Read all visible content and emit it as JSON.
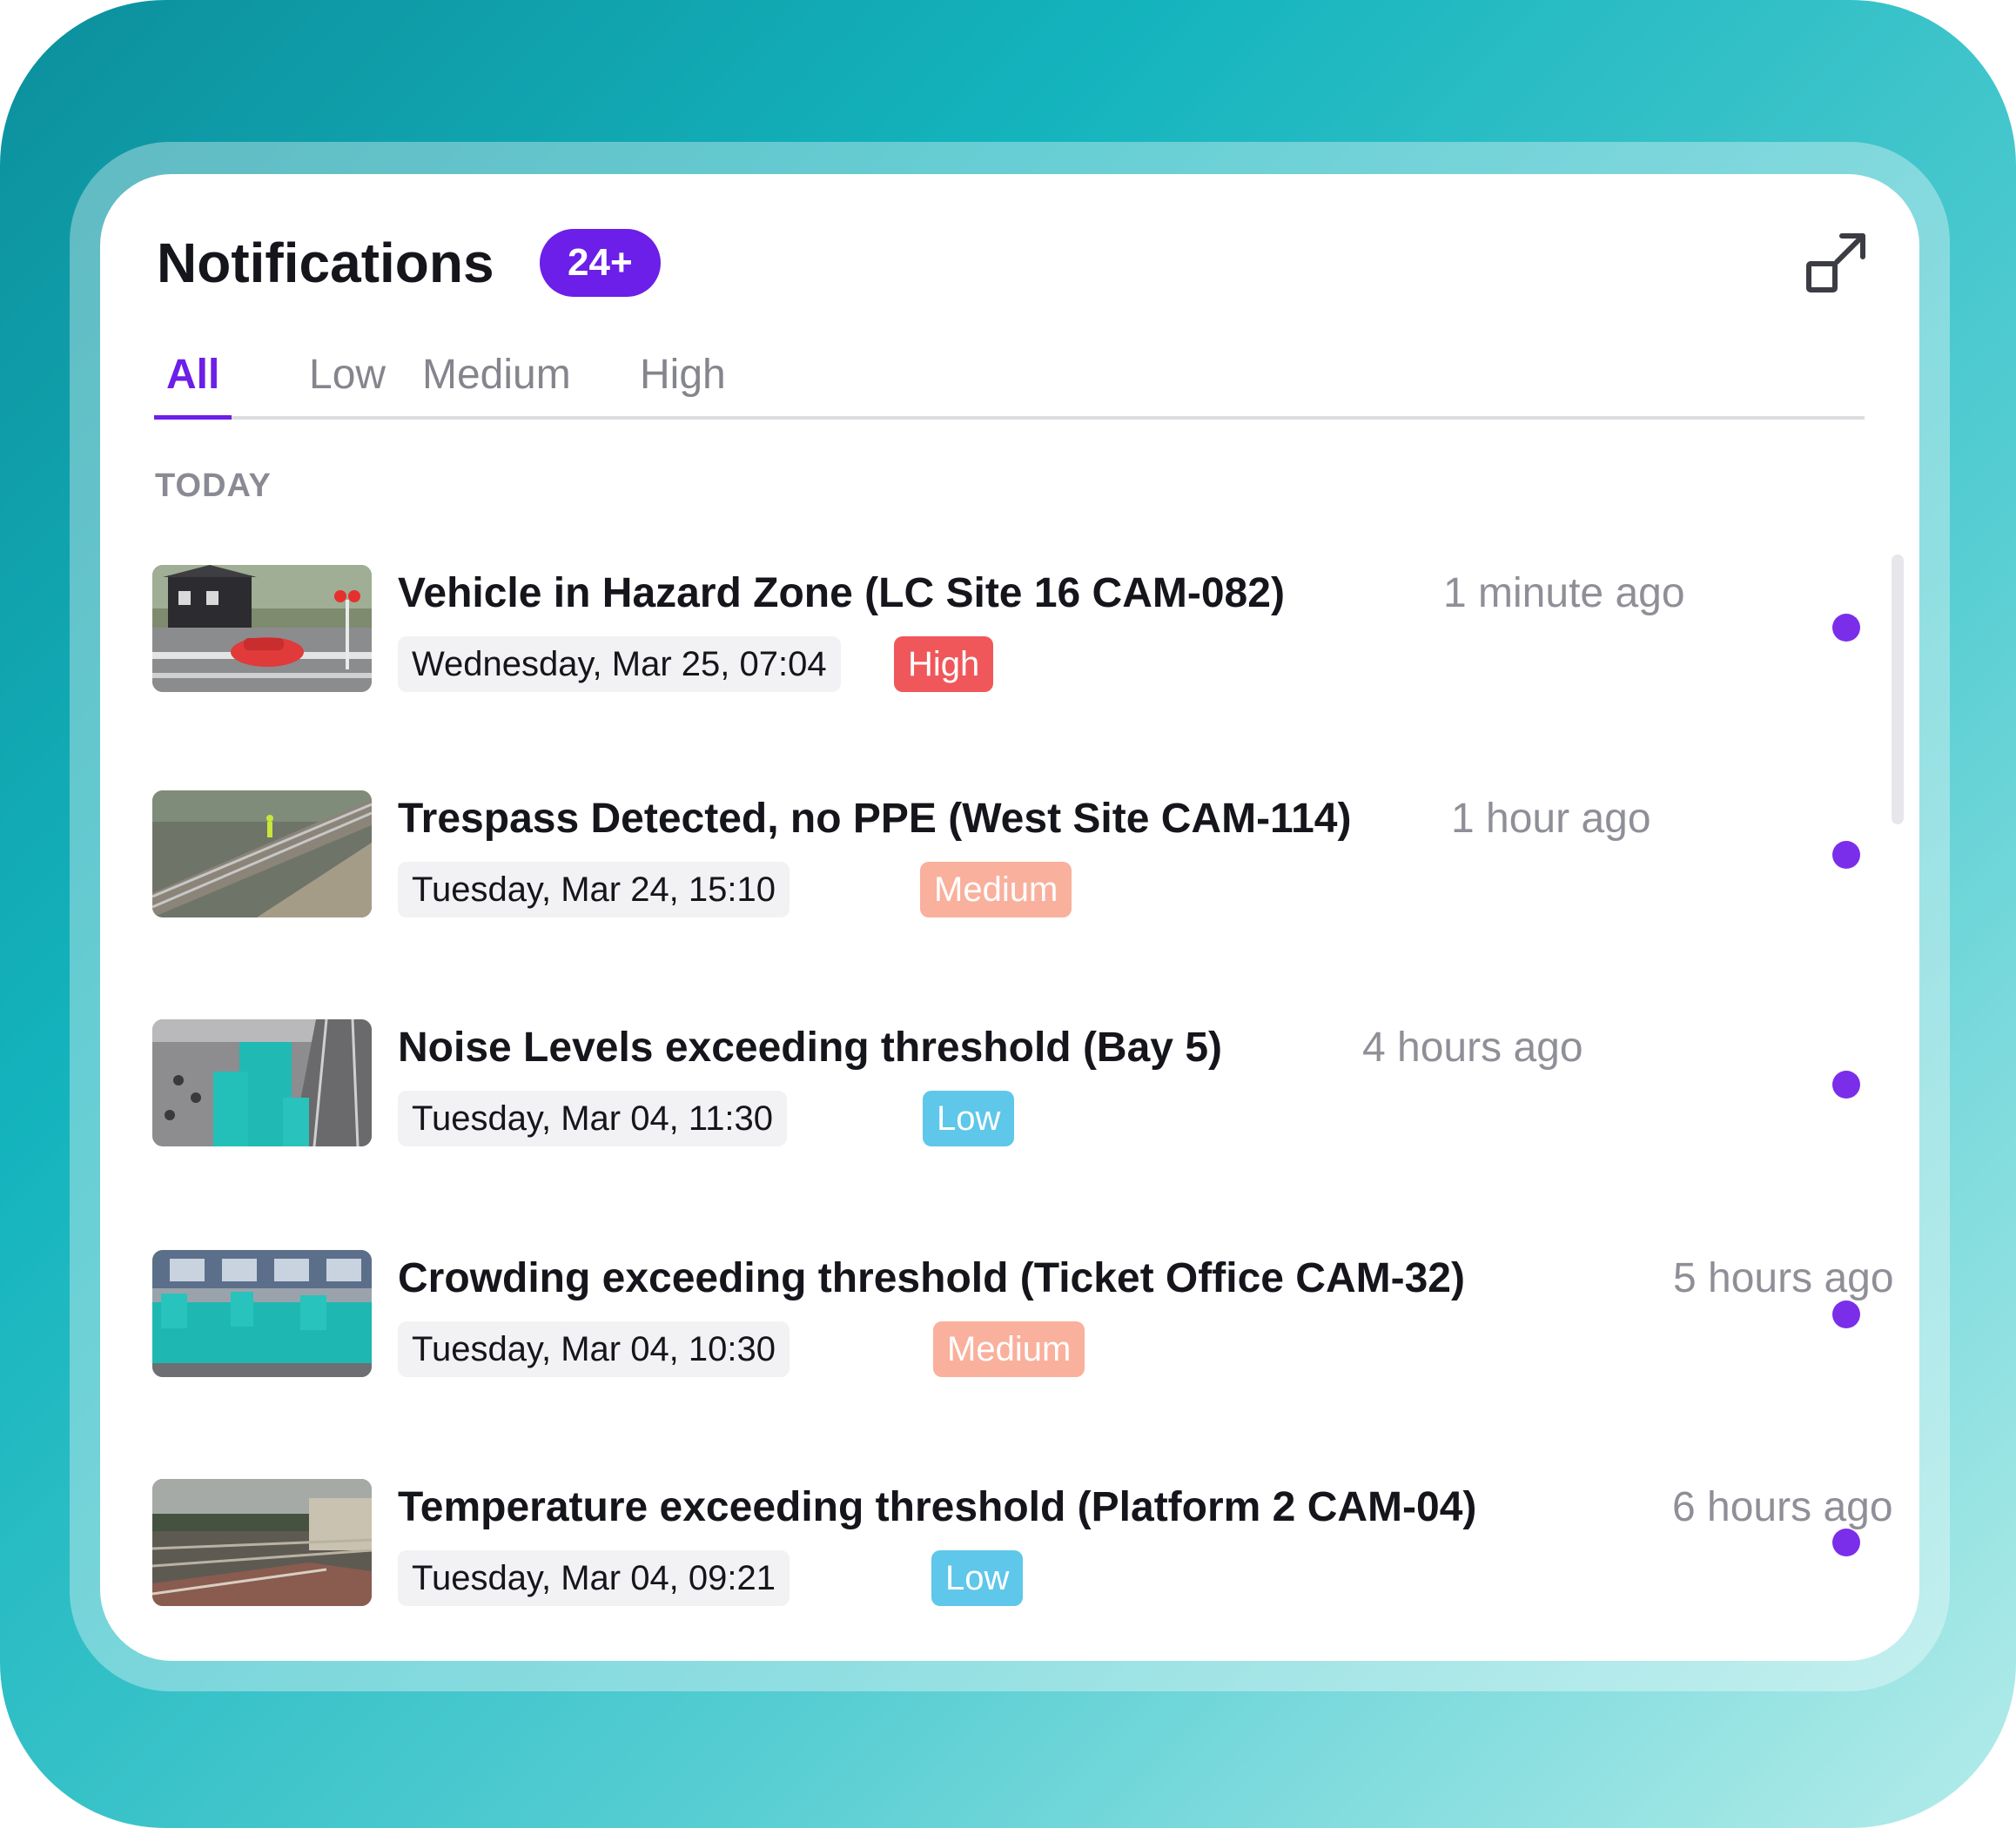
{
  "header": {
    "title": "Notifications",
    "count_badge": "24+",
    "expand_icon": "expand-arrow-icon"
  },
  "tabs": [
    {
      "label": "All",
      "active": true
    },
    {
      "label": "Low",
      "active": false
    },
    {
      "label": "Medium",
      "active": false
    },
    {
      "label": "High",
      "active": false
    }
  ],
  "section_label": "TODAY",
  "colors": {
    "accent": "#6b1fe8",
    "high": "#f0575a",
    "medium": "#f9b09c",
    "low": "#5ec7ea",
    "unread_dot": "#7a2eea"
  },
  "notifications": [
    {
      "title": "Vehicle in Hazard Zone (LC Site 16 CAM-082)",
      "time_ago": "1 minute ago",
      "date": "Wednesday, Mar 25, 07:04",
      "severity": "High",
      "thumbnail": "level-crossing-camera-snapshot",
      "unread": true
    },
    {
      "title": "Trespass Detected, no PPE (West Site CAM-114)",
      "time_ago": "1 hour ago",
      "date": "Tuesday, Mar 24, 15:10",
      "severity": "Medium",
      "thumbnail": "railway-track-camera-snapshot",
      "unread": true
    },
    {
      "title": "Noise Levels exceeding threshold (Bay 5)",
      "time_ago": "4 hours ago",
      "date": "Tuesday, Mar 04, 11:30",
      "severity": "Low",
      "thumbnail": "platform-crowd-camera-snapshot",
      "unread": true
    },
    {
      "title": "Crowding exceeding threshold (Ticket Office CAM-32)",
      "time_ago": "5 hours ago",
      "date": "Tuesday, Mar 04, 10:30",
      "severity": "Medium",
      "thumbnail": "ticket-office-camera-snapshot",
      "unread": true
    },
    {
      "title": "Temperature exceeding threshold (Platform 2 CAM-04)",
      "time_ago": "6 hours ago",
      "date": "Tuesday, Mar 04, 09:21",
      "severity": "Low",
      "thumbnail": "station-yard-camera-snapshot",
      "unread": true
    }
  ]
}
